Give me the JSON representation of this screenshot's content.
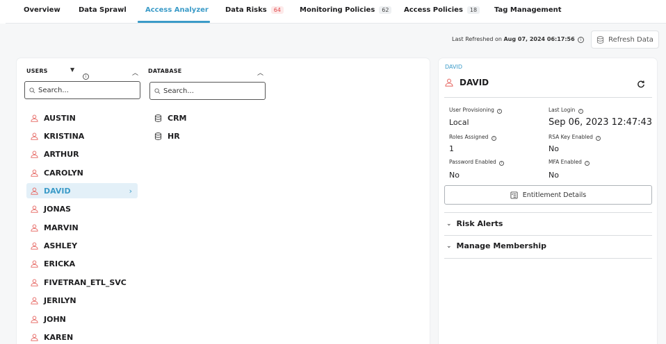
{
  "tabs": [
    {
      "label": "Overview",
      "badge": ""
    },
    {
      "label": "Data Sprawl",
      "badge": ""
    },
    {
      "label": "Access Analyzer",
      "badge": ""
    },
    {
      "label": "Data Risks",
      "badge": "64"
    },
    {
      "label": "Monitoring Policies",
      "badge": "62"
    },
    {
      "label": "Access Policies",
      "badge": "18"
    },
    {
      "label": "Tag Management",
      "badge": ""
    }
  ],
  "active_tab": "Access Analyzer",
  "refresh": {
    "prefix": "Last Refreshed on",
    "timestamp": "Aug 07, 2024 06:17:56",
    "button_label": "Refresh Data"
  },
  "users_column": {
    "header": "USERS",
    "search_placeholder": "Search...",
    "items": [
      "AUSTIN",
      "KRISTINA",
      "ARTHUR",
      "CAROLYN",
      "DAVID",
      "JONAS",
      "MARVIN",
      "ASHLEY",
      "ERICKA",
      "FIVETRAN_ETL_SVC",
      "JERILYN",
      "JOHN",
      "KAREN"
    ],
    "selected": "DAVID"
  },
  "database_column": {
    "header": "DATABASE",
    "search_placeholder": "Search...",
    "items": [
      "CRM",
      "HR"
    ]
  },
  "detail": {
    "breadcrumb": "DAVID",
    "title": "DAVID",
    "fields": {
      "user_provisioning": {
        "label": "User Provisioning",
        "value": "Local"
      },
      "last_login": {
        "label": "Last Login",
        "value": "Sep 06, 2023 12:47:43"
      },
      "roles_assigned": {
        "label": "Roles Assigned",
        "value": "1"
      },
      "rsa_key_enabled": {
        "label": "RSA Key Enabled",
        "value": "No"
      },
      "password_enabled": {
        "label": "Password Enabled",
        "value": "No"
      },
      "mfa_enabled": {
        "label": "MFA Enabled",
        "value": "No"
      }
    },
    "entitlement_button": "Entitlement Details",
    "sections": [
      "Risk Alerts",
      "Manage Membership"
    ]
  },
  "colors": {
    "accent": "#3b9bc8",
    "user_icon": "#e8736f",
    "badge_red": "#e0484a"
  }
}
